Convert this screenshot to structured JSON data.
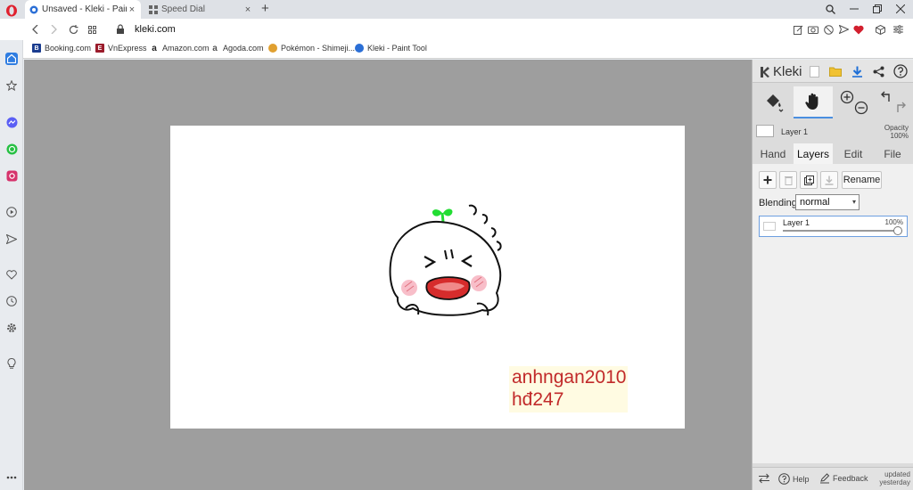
{
  "tabs": [
    {
      "title": "Unsaved - Kleki - Paint Tool",
      "close": "×"
    },
    {
      "title": "Speed Dial",
      "close": "×"
    }
  ],
  "newtab": "+",
  "address": {
    "url": "kleki.com"
  },
  "bookmarks": [
    {
      "label": "Booking.com",
      "icon_text": "B",
      "color": "#1a3c8f"
    },
    {
      "label": "VnExpress",
      "icon_text": "E",
      "color": "#9b1c2c"
    },
    {
      "label": "Amazon.com",
      "icon_text": "a",
      "color": "#222222"
    },
    {
      "label": "Agoda.com",
      "icon_text": "a",
      "color": "#555555"
    },
    {
      "label": "Pokémon - Shimeji...",
      "icon_text": "",
      "color": "#e0a030"
    },
    {
      "label": "Kleki - Paint Tool",
      "icon_text": "",
      "color": "#2b6fd6"
    }
  ],
  "sidebar_icons": [
    "home-icon",
    "star-icon",
    "messenger-icon",
    "whatsapp-icon",
    "instagram-icon",
    "player-icon",
    "send-icon",
    "heart-icon",
    "history-icon",
    "settings-icon",
    "lightbulb-icon",
    "more-icon"
  ],
  "canvas": {
    "signature_line1": "anhngan2010",
    "signature_line2": "hđ247",
    "colors": {
      "work": "#9e9e9e",
      "paper": "#ffffff",
      "sig_text": "#c12a2a",
      "sprout": "#22dd33"
    }
  },
  "kleki": {
    "logo": "Kleki",
    "layer_name": "Layer 1",
    "opacity_label": "Opacity",
    "opacity_value": "100%",
    "panel_tabs": [
      "Hand",
      "Layers",
      "Edit",
      "File"
    ],
    "active_tab": "Layers",
    "rename": "Rename",
    "blending_label": "Blending",
    "blending_value": "normal",
    "layer_item_name": "Layer 1",
    "layer_item_opacity": "100%",
    "layer_opacity_level": 1.0,
    "help": "Help",
    "feedback": "Feedback",
    "updated_line1": "updated",
    "updated_line2": "yesterday"
  }
}
